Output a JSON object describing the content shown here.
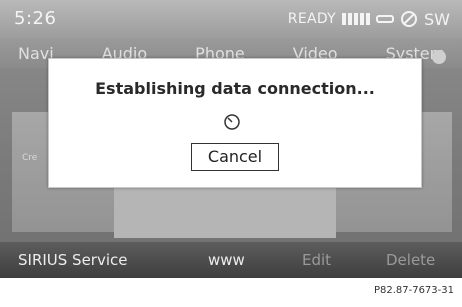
{
  "statusbar": {
    "time": "5:26",
    "ready": "READY",
    "sw": "SW"
  },
  "menubar": {
    "items": [
      "Navi",
      "Audio",
      "Phone",
      "Video",
      "System"
    ]
  },
  "content": {
    "label": "Cre"
  },
  "dialog": {
    "message": "Establishing data connection...",
    "cancel_label": "Cancel"
  },
  "bottombar": {
    "sirius": "SIRIUS Service",
    "www": "www",
    "edit": "Edit",
    "delete": "Delete"
  },
  "footer": {
    "code": "P82.87-7673-31"
  }
}
